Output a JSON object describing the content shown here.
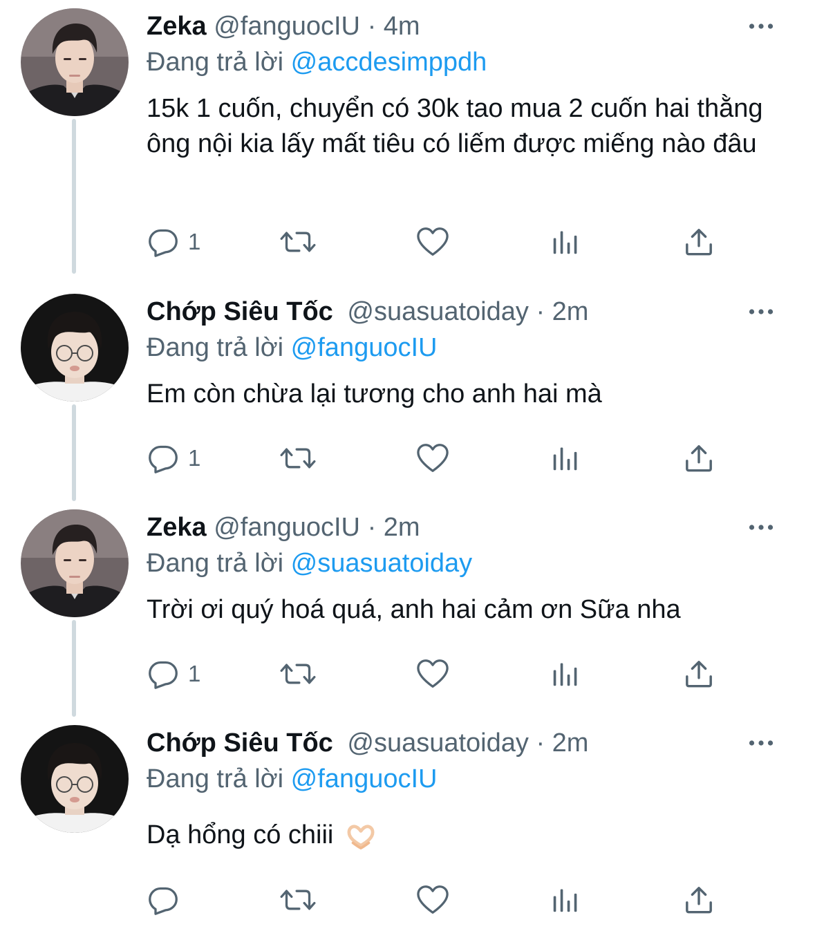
{
  "tweets": [
    {
      "name": "Zeka",
      "handle": "@fanguocIU",
      "time": "4m",
      "reply_prefix": "Đang trả lời",
      "reply_to": "@accdesimppdh",
      "text": "15k 1 cuốn, chuyển có 30k tao mua 2 cuốn hai thằng ông nội kia lấy mất tiêu có liếm được miếng nào đâu",
      "reply_count": "1",
      "avatar": "zeka-avatar"
    },
    {
      "name": "Chớp Siêu Tốc",
      "handle": "@suasuatoiday",
      "time": "2m",
      "reply_prefix": "Đang trả lời",
      "reply_to": "@fanguocIU",
      "text": "Em còn chừa lại tương cho anh hai mà",
      "reply_count": "1",
      "avatar": "chop-avatar"
    },
    {
      "name": "Zeka",
      "handle": "@fanguocIU",
      "time": "2m",
      "reply_prefix": "Đang trả lời",
      "reply_to": "@suasuatoiday",
      "text": "Trời ơi quý hoá quá, anh hai cảm ơn Sữa nha",
      "reply_count": "1",
      "avatar": "zeka-avatar"
    },
    {
      "name": "Chớp Siêu Tốc",
      "handle": "@suasuatoiday",
      "time": "2m",
      "reply_prefix": "Đang trả lời",
      "reply_to": "@fanguocIU",
      "text": "Dạ hổng có chiii",
      "reply_count": "",
      "avatar": "chop-avatar",
      "emoji": "heart-hands-emoji"
    }
  ],
  "separator": "·",
  "icons": [
    "more-icon",
    "reply-icon",
    "retweet-icon",
    "like-icon",
    "views-icon",
    "share-icon"
  ],
  "colors": {
    "text": "#0f1419",
    "secondary": "#536471",
    "link": "#1d9bf0",
    "thread_line": "#cfd9de"
  }
}
